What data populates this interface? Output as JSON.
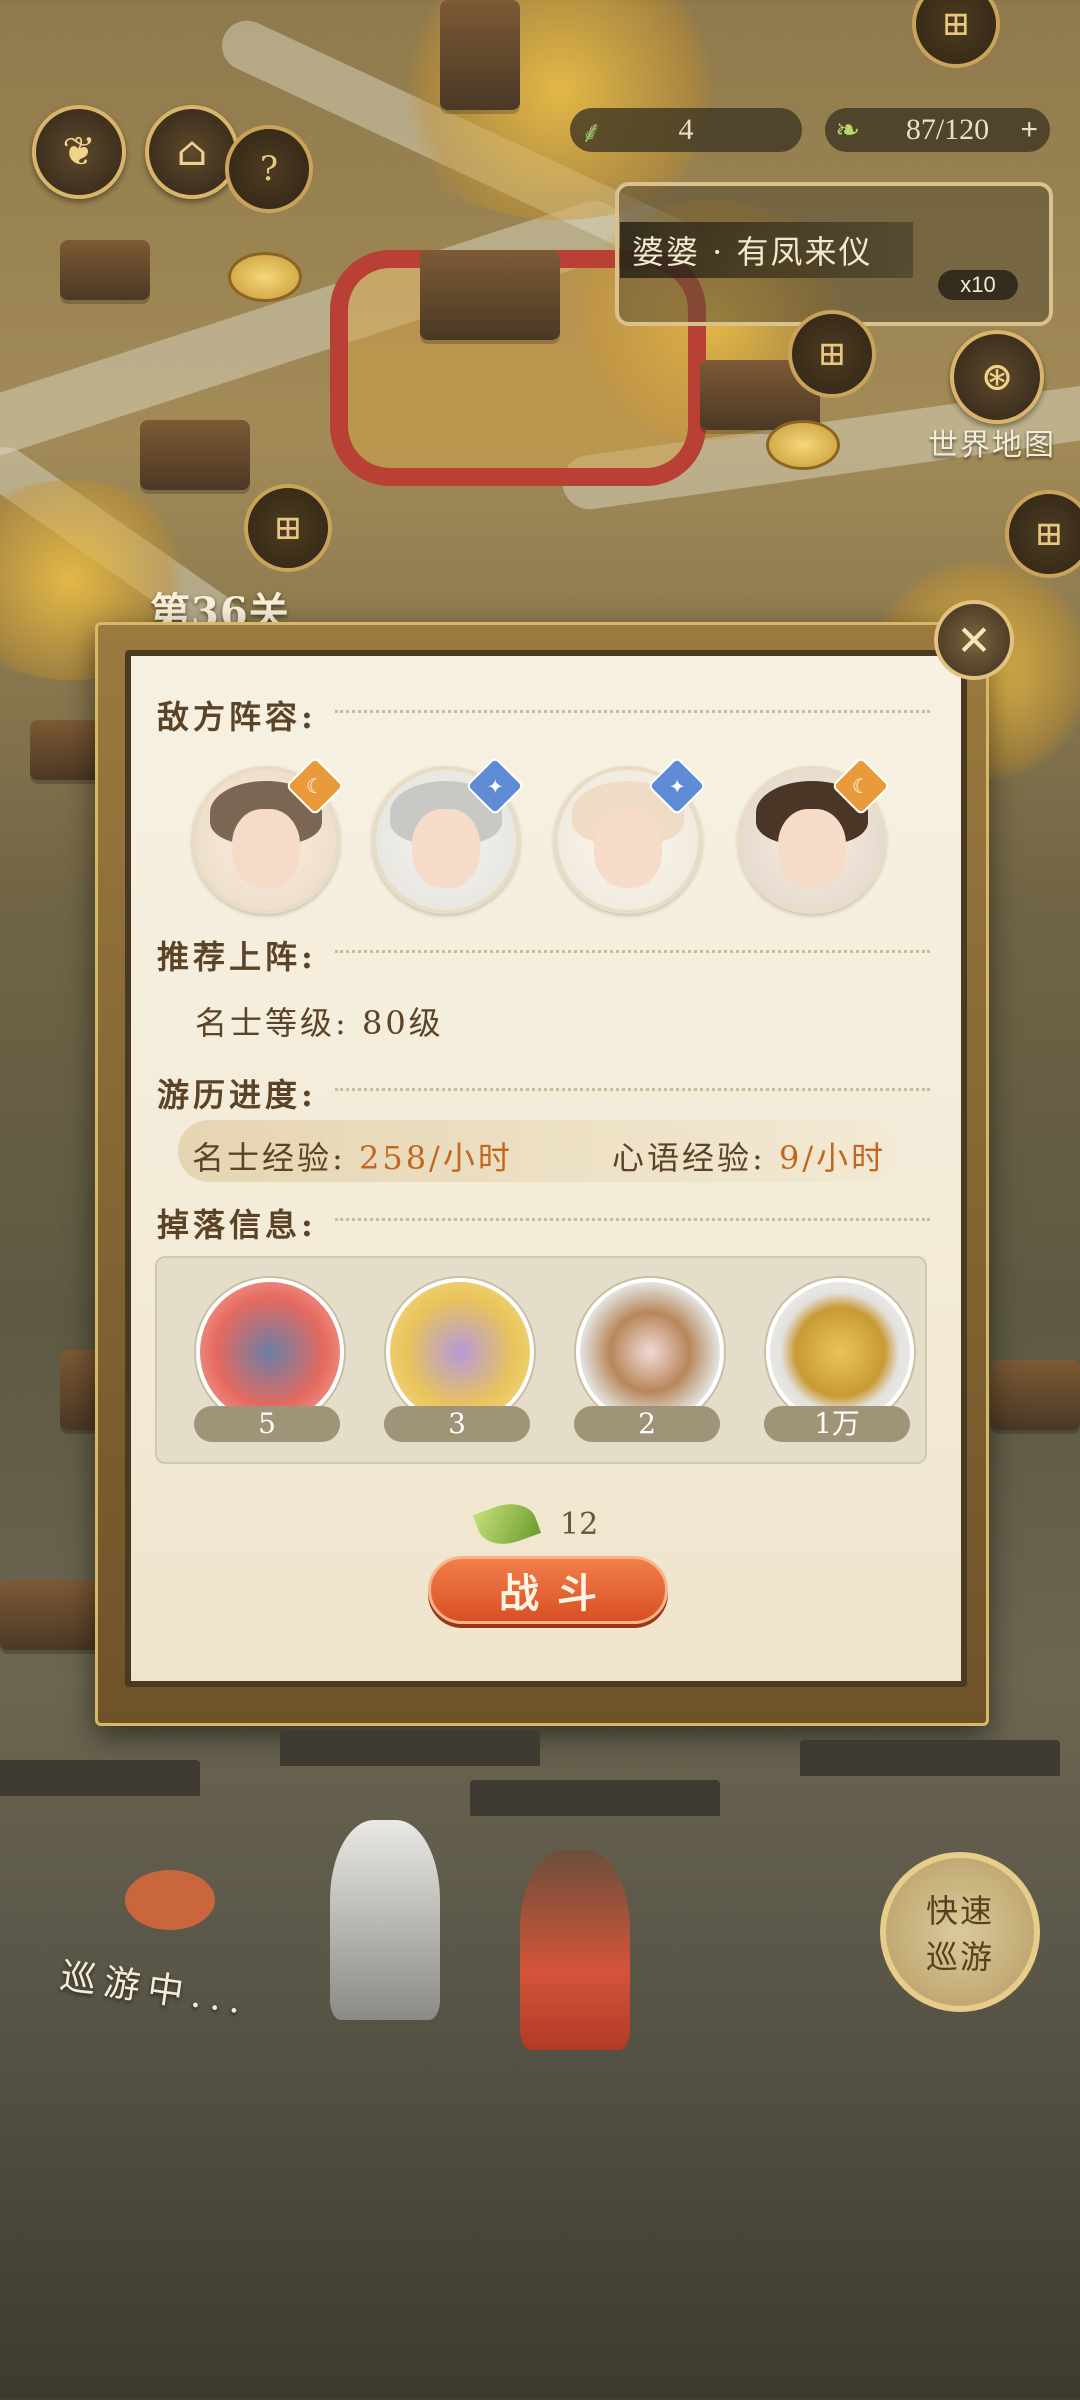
{
  "hud": {
    "energy_value": "4",
    "stamina": "87/120",
    "stamina_add": "+"
  },
  "event": {
    "title": "婆婆 · 有凤来仪",
    "count": "x10"
  },
  "world_map": {
    "label": "世界地图"
  },
  "level": {
    "title": "第36关"
  },
  "panel": {
    "enemy_title": "敌方阵容:",
    "recommend_title": "推荐上阵:",
    "recommend_text": "名士等级: 80级",
    "progress_title": "游历进度:",
    "exp_label_1": "名士经验: ",
    "exp_value_1": "258/小时",
    "exp_label_2": "心语经验: ",
    "exp_value_2": "9/小时",
    "drop_title": "掉落信息:",
    "drops": [
      {
        "icon": "tea-set-icon",
        "count": "5"
      },
      {
        "icon": "scroll-flower-icon",
        "count": "3"
      },
      {
        "icon": "rice-bowl-icon",
        "count": "2"
      },
      {
        "icon": "coin-icon",
        "count": "1万"
      }
    ],
    "cost": "12",
    "fight_label": "战斗"
  },
  "bottom": {
    "fast_travel_1": "快速",
    "fast_travel_2": "巡游",
    "traveling": "巡游中..."
  },
  "colors": {
    "accent_gold": "#d9b766",
    "fight_button": "#d94f24",
    "value_orange": "#c2671d",
    "temple_red": "#b84034"
  }
}
